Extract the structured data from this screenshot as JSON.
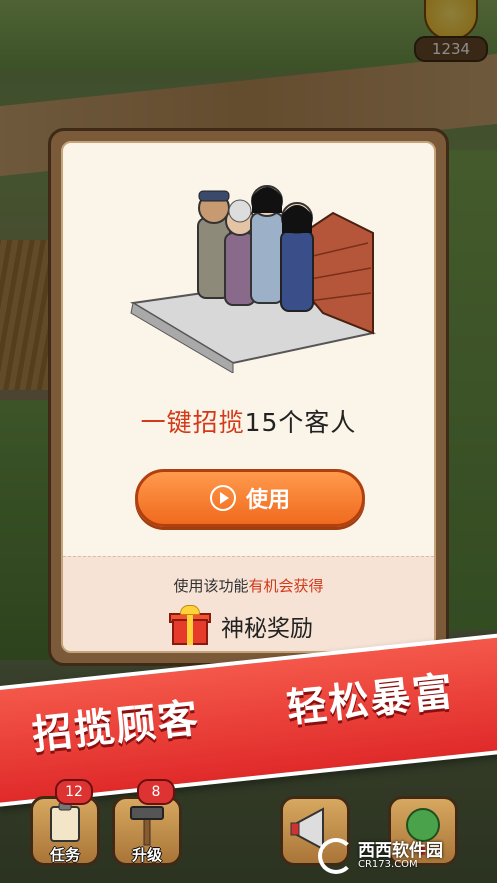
{
  "hud": {
    "coin_count": "1234"
  },
  "dialog": {
    "title_highlight": "一键招揽",
    "title_rest": "15个客人",
    "use_button_label": "使用",
    "reward_hint_prefix": "使用该功能",
    "reward_hint_highlight": "有机会获得",
    "reward_name": "神秘奖励"
  },
  "banner": {
    "left_text": "招揽顾客",
    "right_text": "轻松暴富"
  },
  "toolbar": {
    "tasks": {
      "label": "任务",
      "badge": "12"
    },
    "upgrade": {
      "label": "升级",
      "badge": "8"
    }
  },
  "watermark": {
    "main": "西西软件园",
    "sub": "CR173.COM"
  },
  "colors": {
    "accent": "#f06a1e",
    "highlight": "#d23a1a",
    "banner": "#e02a2a"
  }
}
